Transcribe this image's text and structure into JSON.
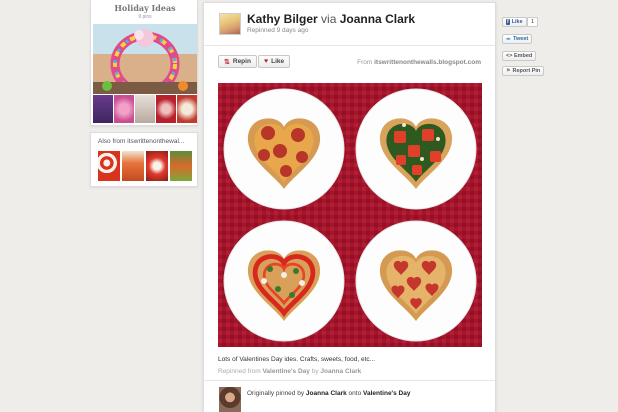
{
  "board": {
    "title": "Holiday Ideas",
    "pin_count": "9 pins"
  },
  "also_from": {
    "title": "Also from itswrittenonthewal..."
  },
  "pin": {
    "pinner_name": "Kathy Bilger",
    "via_label": "via",
    "via_name": "Joanna Clark",
    "repinned_when": "Repinned 9 days ago",
    "repin_label": "Repin",
    "like_label": "Like",
    "source_prefix": "From",
    "source_domain": "itswrittenonthewalls.blogspot.com",
    "description": "Lots of Valentines Day ides. Crafts, sweets, food, etc...",
    "repinned_from_prefix": "Repinned from",
    "repinned_from_board": "Valentine's Day",
    "repinned_from_by": "by",
    "repinned_from_user": "Joanna Clark",
    "orig_prefix": "Originally pinned by",
    "orig_user": "Joanna Clark",
    "orig_onto": "onto",
    "orig_board": "Valentine's Day"
  },
  "sidebar": {
    "fb_like_label": "Like",
    "fb_like_count": "1",
    "tweet_label": "Tweet",
    "embed_label": "<> Embed",
    "report_label": "Report Pin"
  },
  "colors": {
    "background": "#efedea",
    "pizza_backdrop": "#a3152b",
    "link_blue": "#3b5998"
  }
}
